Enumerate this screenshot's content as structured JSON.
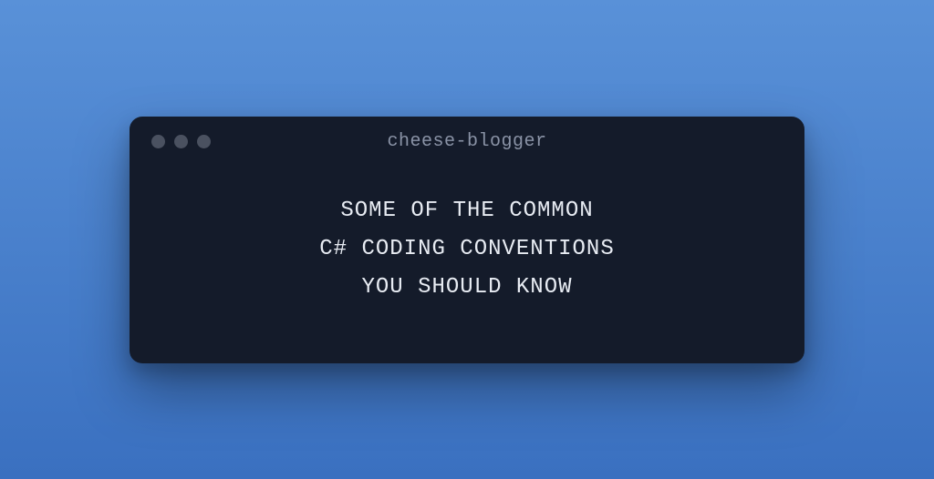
{
  "window": {
    "title": "cheese-blogger"
  },
  "content": {
    "line1": "SOME OF THE COMMON",
    "line2": "C# CODING CONVENTIONS",
    "line3": "YOU SHOULD KNOW"
  }
}
